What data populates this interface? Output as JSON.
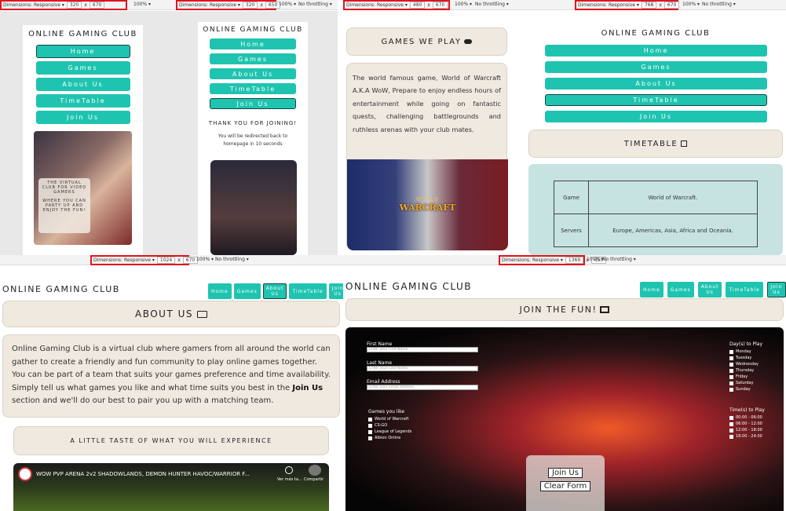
{
  "site": {
    "title": "ONLINE GAMING CLUB",
    "nav": [
      "Home",
      "Games",
      "About Us",
      "TimeTable",
      "Join Us"
    ]
  },
  "devtools": {
    "label": "Dimensions: Responsive ▾",
    "zoom": "100% ▾",
    "throttle": "No throttling ▾",
    "x": "x",
    "panels": [
      {
        "w": "320",
        "h": "670"
      },
      {
        "w": "320",
        "h": "650"
      },
      {
        "w": "480",
        "h": "670"
      },
      {
        "w": "768",
        "h": "670"
      },
      {
        "w": "1024",
        "h": "670"
      },
      {
        "w": "1369",
        "h": "650"
      }
    ]
  },
  "p1": {
    "hero_text": "THE VIRTUAL CLUB FOR VIDEO GAMERS",
    "hero_text2": "WHERE YOU CAN PARTY UP AND ENJOY THE FUN!"
  },
  "p2": {
    "thanks": "THANK YOU FOR JOINING!",
    "redirect": "You will be redirected back to homepage in 10 seconds"
  },
  "p3": {
    "heading": "GAMES WE PLAY",
    "text": "The world famous game, World of Warcraft A.K.A WoW, Prepare to enjoy endless hours of entertainment while going on fantastic quests, challenging battlegrounds and ruthless arenas with your club mates.",
    "logo_top": "WORLD",
    "logo_main": "WARCRAFT"
  },
  "p4": {
    "heading": "TIMETABLE",
    "rows": [
      [
        "Game",
        "World of Warcraft."
      ],
      [
        "Servers",
        "Europe, Americas, Asia, Africa and Oceania."
      ]
    ]
  },
  "p5": {
    "heading": "ABOUT US",
    "text_a": "Online Gaming Club is a virtual club where gamers from all around the world can gather to create a friendly and fun community to play online games together. You can be part of a team that suits your games preference and time availability. Simply tell us what games you like and what time suits you best in the ",
    "text_link": "Join Us",
    "text_b": " section and we'll do our best to pair you up with a matching team.",
    "taste": "A LITTLE TASTE OF WHAT YOU WILL EXPERIENCE",
    "video_title": "WOW PVP ARENA 2v2 SHADOWLANDS, DEMON HUNTER HAVOC/WARRIOR F...",
    "watch_later": "Ver más ta...",
    "share": "Compartir"
  },
  "p6": {
    "heading": "JOIN THE FUN!",
    "first_name": "First Name",
    "first_ph": "Enter your First Name",
    "last_name": "Last Name",
    "last_ph": "Enter your Last Name",
    "email": "Email Address",
    "email_ph": "Enter your Email Address",
    "games_label": "Games you like",
    "games": [
      "World of Warcraft",
      "CS:GO",
      "League of Legends",
      "Albion Online"
    ],
    "days_label": "Day(s) to Play",
    "days": [
      "Monday",
      "Tuesday",
      "Wednesday",
      "Thursday",
      "Friday",
      "Saturday",
      "Sunday"
    ],
    "times_label": "Time(s) to Play",
    "times": [
      "00:00 - 06:00",
      "06:00 - 12:00",
      "12:00 - 18:00",
      "18:00 - 24:00"
    ],
    "join_btn": "Join Us",
    "clear_btn": "Clear Form"
  },
  "colors": {
    "accent": "#1fc4b0",
    "beige": "#efe9e0",
    "highlight": "#e0141e"
  }
}
